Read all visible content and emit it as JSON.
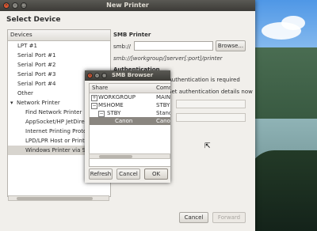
{
  "window": {
    "title": "New Printer",
    "heading": "Select Device"
  },
  "devices": {
    "header": "Devices",
    "items": [
      {
        "label": "LPT #1"
      },
      {
        "label": "Serial Port #1"
      },
      {
        "label": "Serial Port #2"
      },
      {
        "label": "Serial Port #3"
      },
      {
        "label": "Serial Port #4"
      },
      {
        "label": "Other"
      }
    ],
    "network_label": "Network Printer",
    "network_items": [
      {
        "label": "Find Network Printer"
      },
      {
        "label": "AppSocket/HP JetDirect"
      },
      {
        "label": "Internet Printing Protocol"
      },
      {
        "label": "LPD/LPR Host or Printer"
      },
      {
        "label": "Windows Printer via SAMBA"
      }
    ]
  },
  "smb": {
    "title": "SMB Printer",
    "prefix": "smb://",
    "value": "",
    "browse_label": "Browse...",
    "hint": "smb://[workgroup/]server[:port]/printer",
    "auth_heading": "Authentication",
    "auth_required": "Authentication is required",
    "auth_details": "Set authentication details now",
    "field1_value": "",
    "field2_value": ""
  },
  "buttons": {
    "cancel": "Cancel",
    "forward": "Forward"
  },
  "smb_browser": {
    "title": "SMB Browser",
    "columns": [
      "Share",
      "Comment"
    ],
    "rows": [
      {
        "expander": "+",
        "name": "WORKGROUP",
        "comment": "MAIN"
      },
      {
        "expander": "−",
        "name": "MSHOME",
        "comment": "STBY"
      },
      {
        "expander": "−",
        "name": "STBY",
        "comment": "Standard"
      },
      {
        "expander": "",
        "name": "Canon",
        "comment": "Canon"
      }
    ],
    "refresh_label": "Refresh",
    "cancel_label": "Cancel",
    "ok_label": "OK"
  },
  "colors": {
    "titlebar": "#3c3b37",
    "close_button": "#e4562f",
    "selection": "#8a8680"
  }
}
